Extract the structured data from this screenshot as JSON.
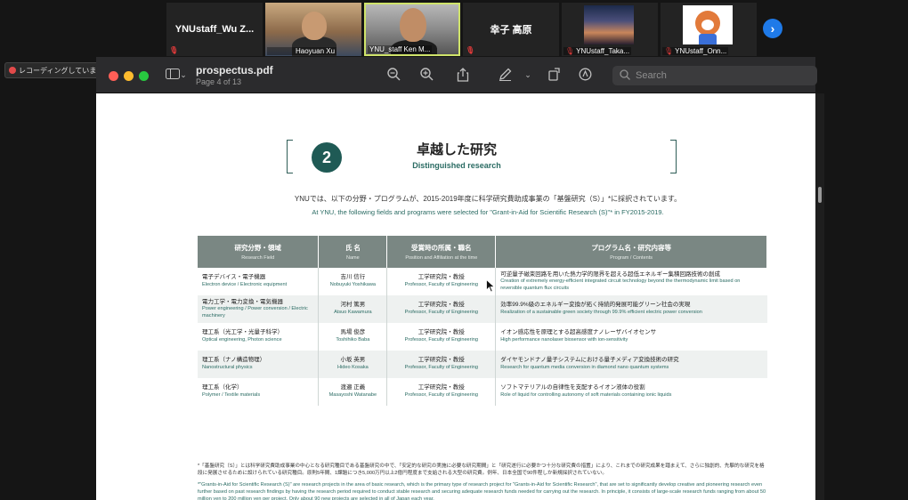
{
  "participants": [
    {
      "name": "YNUstaff_Wu  Z...",
      "type": "name-only"
    },
    {
      "name": "Haoyuan Xu",
      "type": "video"
    },
    {
      "name": "YNU_staff Ken M...",
      "type": "video"
    },
    {
      "name": "幸子 高原",
      "type": "name-only"
    },
    {
      "name": "YNUstaff_Taka...",
      "type": "image"
    },
    {
      "name": "YNUstaff_Onn...",
      "type": "avatar"
    }
  ],
  "recording_label": "レコーディングしています...",
  "viewer": {
    "file_name": "prospectus.pdf",
    "page_info": "Page 4 of 13",
    "search_placeholder": "Search"
  },
  "section": {
    "number": "2",
    "title_ja": "卓越した研究",
    "title_en": "Distinguished research",
    "intro_ja": "YNUでは、以下の分野・プログラムが、2015-2019年度に科学研究費助成事業の「基盤研究（S）」*に採択されています。",
    "intro_en": "At YNU, the following fields and programs were selected for \"Grant-in-Aid for Scientific Research (S)\"* in FY2015-2019."
  },
  "table": {
    "headers": [
      {
        "ja": "研究分野・領域",
        "en": "Research Field"
      },
      {
        "ja": "氏 名",
        "en": "Name"
      },
      {
        "ja": "受賞時の所属・職名",
        "en": "Position and Affiliation at the time"
      },
      {
        "ja": "プログラム名・研究内容等",
        "en": "Program / Contents"
      }
    ],
    "rows": [
      {
        "field_ja": "電子デバイス・電子機器",
        "field_en": "Electron device / Electronic equipment",
        "name_ja": "吉川 信行",
        "name_en": "Nobuyuki Yoshikawa",
        "pos_ja": "工学研究院・教授",
        "pos_en": "Professor, Faculty of Engineering",
        "prog_ja": "可逆量子磁束回路を用いた熱力学的限界を超える超低エネルギー集積回路技術の創成",
        "prog_en": "Creation of extremely energy-efficient integrated circuit technology beyond the thermodynamic limit based on reversible quantum flux circuits"
      },
      {
        "field_ja": "電力工学・電力変換・電気機器",
        "field_en": "Power engineering / Power conversion / Electric machinery",
        "name_ja": "河村 篤男",
        "name_en": "Atsuo Kawamura",
        "pos_ja": "工学研究院・教授",
        "pos_en": "Professor, Faculty of Engineering",
        "prog_ja": "効率99.9%級のエネルギー変換が拓く持続的発展可能グリーン社会の実現",
        "prog_en": "Realization of a sustainable green society through 99.9% efficient electric power conversion"
      },
      {
        "field_ja": "理工系（光工学・光量子科学）",
        "field_en": "Optical engineering, Photon science",
        "name_ja": "馬場 俊彦",
        "name_en": "Toshihiko Baba",
        "pos_ja": "工学研究院・教授",
        "pos_en": "Professor, Faculty of Engineering",
        "prog_ja": "イオン感応性を原理とする超高感度ナノレーザバイオセンサ",
        "prog_en": "High performance nanolaser biosensor with ion-sensitivity"
      },
      {
        "field_ja": "理工系（ナノ構造物理）",
        "field_en": "Nanostructural physics",
        "name_ja": "小坂 英男",
        "name_en": "Hideo Kosaka",
        "pos_ja": "工学研究院・教授",
        "pos_en": "Professor, Faculty of Engineering",
        "prog_ja": "ダイヤモンドナノ量子システムにおける量子メディア変換技術の研究",
        "prog_en": "Research for quantum media conversion in diamond nano quantum systems"
      },
      {
        "field_ja": "理工系（化学）",
        "field_en": "Polymer / Textile materials",
        "name_ja": "渡邉 正義",
        "name_en": "Masayoshi Watanabe",
        "pos_ja": "工学研究院・教授",
        "pos_en": "Professor, Faculty of Engineering",
        "prog_ja": "ソフトマテリアルの自律性を支配するイオン液体の役割",
        "prog_en": "Role of liquid for controlling autonomy of soft materials containing ionic liquids"
      }
    ]
  },
  "footnote_ja": "*「基盤研究（S）」とは科学研究費助成事業の中心となる研究種目である基盤研究の中で、「安定的な研究の実施に必要な研究期間」と「研究遂行に必要かつ十分な研究費の措置」により、これまでの研究成果を踏まえて、さらに独創的、先駆的な研究を格段に発展させるために設けられている研究種目。原則5年間、1課題につき5,000万円以上2億円程度まで支給される大型の研究費。例年、日本全国で90件程しか新規採択されていない。",
  "footnote_en": "*\"Grants-in-Aid for Scientific Research (S)\" are research projects in the area of basic research, which is the primary type of research project for \"Grants-in-Aid for Scientific Research\", that are set to significantly develop creative and pioneering research even further based on past research findings by having the research period required to conduct stable research and securing adequate research funds needed for carrying out the research. In principle, it consists of large-scale research funds ranging from about 50 million yen to 200 million yen per project. Only about 90 new projects are selected in all of Japan each year."
}
